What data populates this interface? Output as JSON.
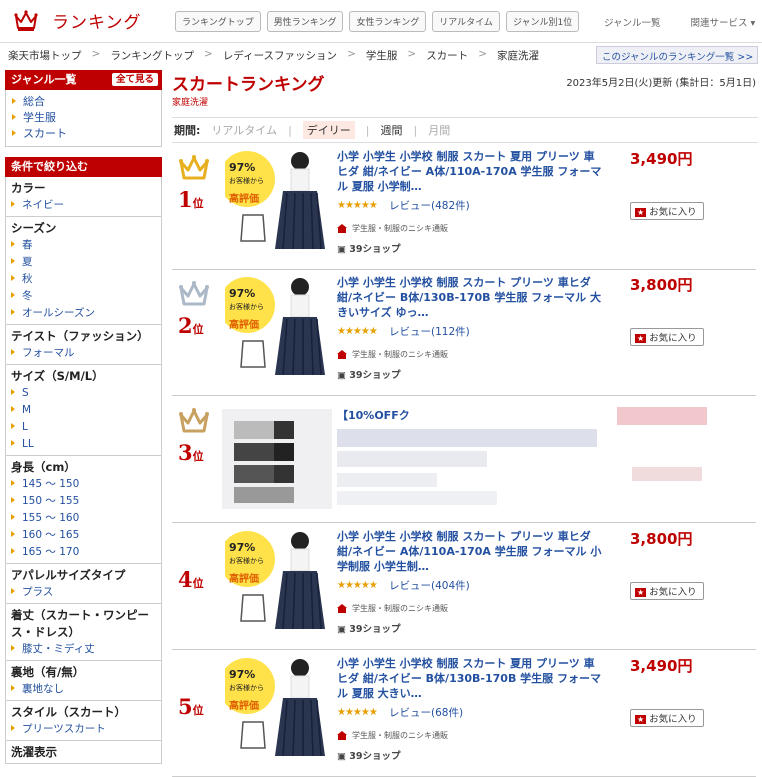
{
  "header": {
    "logo_text": "ランキング",
    "nav": [
      "ランキングトップ",
      "男性ランキング",
      "女性ランキング",
      "リアルタイム",
      "ジャンル別1位"
    ],
    "right": [
      "ジャンル一覧",
      "関連サービス ▾"
    ]
  },
  "breadcrumb": [
    "楽天市場トップ",
    "ランキングトップ",
    "レディースファッション",
    "学生服",
    "スカート",
    "家庭洗濯"
  ],
  "breadcrumb_link": "このジャンルのランキング一覧 >>",
  "sidebar": {
    "genre_title": "ジャンル一覧",
    "genre_btn": "全て見る",
    "genres": [
      "総合",
      "学生服",
      "スカート"
    ],
    "filter_title": "条件で絞り込む",
    "groups": [
      {
        "title": "カラー",
        "items": [
          "ネイビー"
        ]
      },
      {
        "title": "シーズン",
        "items": [
          "春",
          "夏",
          "秋",
          "冬",
          "オールシーズン"
        ]
      },
      {
        "title": "テイスト（ファッション）",
        "items": [
          "フォーマル"
        ]
      },
      {
        "title": "サイズ（S/M/L）",
        "items": [
          "S",
          "M",
          "L",
          "LL"
        ]
      },
      {
        "title": "身長（cm）",
        "items": [
          "145 ～ 150",
          "150 ～ 155",
          "155 ～ 160",
          "160 ～ 165",
          "165 ～ 170"
        ]
      },
      {
        "title": "アパレルサイズタイプ",
        "items": [
          "プラス"
        ]
      },
      {
        "title": "着丈（スカート・ワンピース・ドレス）",
        "items": [
          "膝丈・ミディ丈"
        ]
      },
      {
        "title": "裏地（有/無）",
        "items": [
          "裏地なし"
        ]
      },
      {
        "title": "スタイル（スカート）",
        "items": [
          "プリーツスカート"
        ]
      },
      {
        "title": "洗濯表示",
        "items": []
      }
    ]
  },
  "main": {
    "title": "スカートランキング",
    "subtitle": "家庭洗濯",
    "updated": "2023年5月2日(火)更新 (集計日：5月1日)",
    "period_label": "期間:",
    "periods": [
      "リアルタイム",
      "デイリー",
      "週間",
      "月間"
    ],
    "active_period": "デイリー"
  },
  "items": [
    {
      "rank": "1",
      "unit": "位",
      "crown": "#e8b020",
      "name": "小学 小学生 小学校 制服 スカート 夏用 プリーツ 車ヒダ 紺/ネイビー A体/110A-170A 学生服 フォーマル 夏服 小学制…",
      "stars": "★★★★★",
      "reviews": "レビュー(482件)",
      "shop": "学生服・制服のニシキ通販",
      "points": "39ショップ",
      "price": "3,490円",
      "fav": "お気に入り"
    },
    {
      "rank": "2",
      "unit": "位",
      "crown": "#aab8c8",
      "name": "小学 小学生 小学校 制服 スカート プリーツ 車ヒダ 紺/ネイビー B体/130B-170B 学生服 フォーマル 大きいサイズ ゆっ…",
      "stars": "★★★★★",
      "reviews": "レビュー(112件)",
      "shop": "学生服・制服のニシキ通販",
      "points": "39ショップ",
      "price": "3,800円",
      "fav": "お気に入り"
    },
    {
      "rank": "3",
      "unit": "位",
      "crown": "#c8a060",
      "name": "【10%OFFク",
      "stars": "",
      "reviews": "",
      "shop": "",
      "points": "",
      "price": "",
      "fav": ""
    },
    {
      "rank": "4",
      "unit": "位",
      "crown": "none",
      "name": "小学 小学生 小学校 制服 スカート プリーツ 車ヒダ 紺/ネイビー A体/110A-170A 学生服 フォーマル 小学制服 小学生制…",
      "stars": "★★★★★",
      "reviews": "レビュー(404件)",
      "shop": "学生服・制服のニシキ通販",
      "points": "39ショップ",
      "price": "3,800円",
      "fav": "お気に入り"
    },
    {
      "rank": "5",
      "unit": "位",
      "crown": "none",
      "name": "小学 小学生 小学校 制服 スカート 夏用 プリーツ 車ヒダ 紺/ネイビー B体/130B-170B 学生服 フォーマル 夏服 大きい…",
      "stars": "★★★★★",
      "reviews": "レビュー(68件)",
      "shop": "学生服・制服のニシキ通販",
      "points": "39ショップ",
      "price": "3,490円",
      "fav": "お気に入り"
    }
  ],
  "thumb": {
    "badge_line1": "97",
    "badge_line2": "お客様から",
    "badge_line3": "高評価"
  }
}
